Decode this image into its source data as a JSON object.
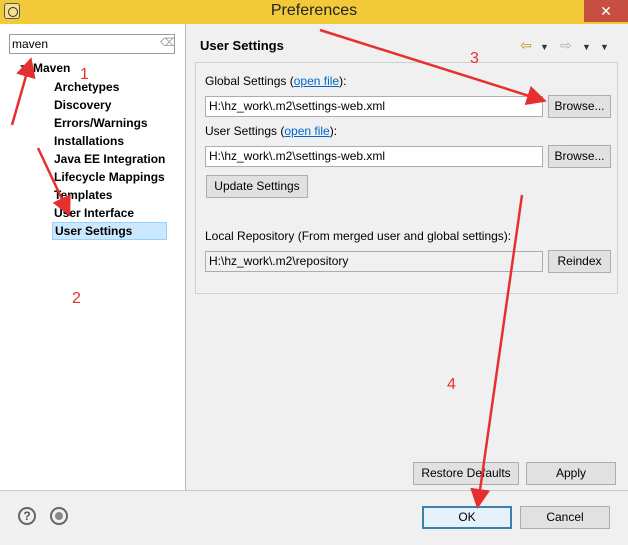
{
  "window": {
    "title": "Preferences",
    "close_glyph": "✕"
  },
  "search": {
    "value": "maven",
    "clear_glyph": "⌫"
  },
  "tree": {
    "root_label": "Maven",
    "items": [
      {
        "label": "Archetypes"
      },
      {
        "label": "Discovery"
      },
      {
        "label": "Errors/Warnings"
      },
      {
        "label": "Installations"
      },
      {
        "label": "Java EE Integration"
      },
      {
        "label": "Lifecycle Mappings"
      },
      {
        "label": "Templates"
      },
      {
        "label": "User Interface"
      },
      {
        "label": "User Settings",
        "selected": true
      }
    ]
  },
  "page": {
    "header": "User Settings",
    "nav": {
      "back": "⇦",
      "forward": "⇨",
      "menu": "▼"
    }
  },
  "global_settings": {
    "label_prefix": "Global Settings (",
    "link": "open file",
    "label_suffix": "):",
    "path": "H:\\hz_work\\.m2\\settings-web.xml",
    "browse": "Browse..."
  },
  "user_settings": {
    "label_prefix": "User Settings (",
    "link": "open file",
    "label_suffix": "):",
    "path": "H:\\hz_work\\.m2\\settings-web.xml",
    "browse": "Browse...",
    "update": "Update Settings"
  },
  "local_repository": {
    "label": "Local Repository (From merged user and global settings):",
    "path": "H:\\hz_work\\.m2\\repository",
    "reindex": "Reindex"
  },
  "actions": {
    "restore_defaults": "Restore Defaults",
    "apply": "Apply",
    "ok": "OK",
    "cancel": "Cancel",
    "help_glyph": "?"
  },
  "annotations": {
    "a1": "1",
    "a2": "2",
    "a3": "3",
    "a4": "4",
    "color": "#e63030"
  },
  "icons": [
    "app-icon",
    "close-icon",
    "clear-icon",
    "back-icon",
    "forward-icon",
    "menu-icon",
    "help-icon",
    "import-icon"
  ]
}
